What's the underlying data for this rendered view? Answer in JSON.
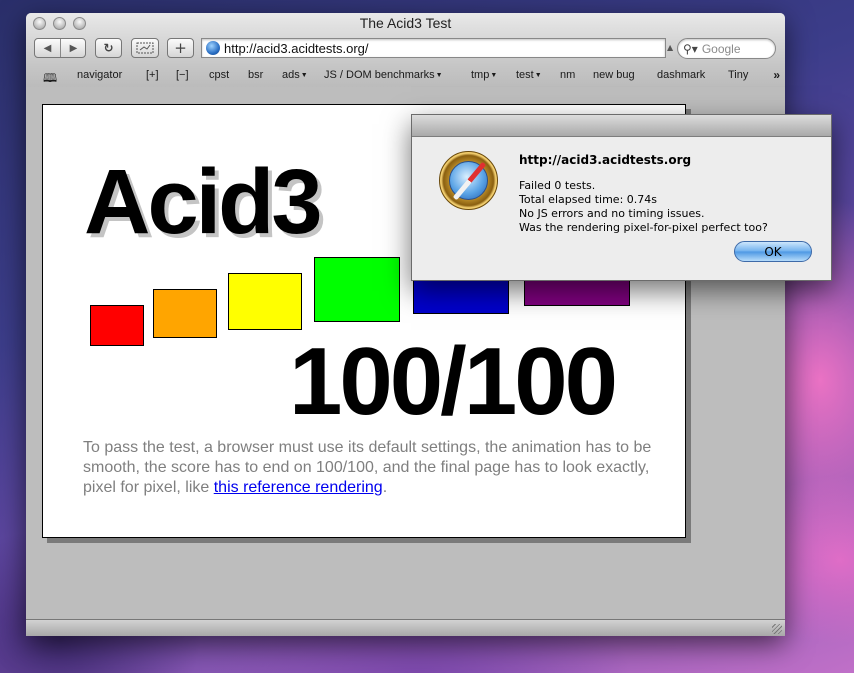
{
  "window": {
    "title": "The Acid3 Test",
    "url": "http://acid3.acidtests.org/",
    "search_placeholder": "Google"
  },
  "toolbar": {
    "back_icon": "back-arrow-icon",
    "forward_icon": "forward-arrow-icon",
    "reload_icon": "reload-icon",
    "add_bookmark_label": "+"
  },
  "bookmarks": {
    "items": [
      {
        "label": "navigator",
        "dropdown": false
      },
      {
        "label": "[+]",
        "dropdown": false
      },
      {
        "label": "[−]",
        "dropdown": false
      },
      {
        "label": "cpst",
        "dropdown": false
      },
      {
        "label": "bsr",
        "dropdown": false
      },
      {
        "label": "ads",
        "dropdown": true
      },
      {
        "label": "JS / DOM benchmarks",
        "dropdown": true
      },
      {
        "label": "tmp",
        "dropdown": true
      },
      {
        "label": "test",
        "dropdown": true
      },
      {
        "label": "nm",
        "dropdown": false
      },
      {
        "label": "new bug",
        "dropdown": false
      },
      {
        "label": "dashmark",
        "dropdown": false
      },
      {
        "label": "Tiny",
        "dropdown": false
      }
    ],
    "overflow": "»"
  },
  "page": {
    "title": "Acid3",
    "score": "100/100",
    "description": "To pass the test, a browser must use its default settings, the animation has to be smooth, the score has to end on 100/100, and the final page has to look exactly, pixel for pixel, like ",
    "link_text": "this reference rendering",
    "description_end": ".",
    "boxes": [
      {
        "color": "#ff0000"
      },
      {
        "color": "#ffa500"
      },
      {
        "color": "#ffff00"
      },
      {
        "color": "#00ff00"
      },
      {
        "color": "#0000cc"
      },
      {
        "color": "#800080"
      }
    ]
  },
  "dialog": {
    "url": "http://acid3.acidtests.org",
    "lines": [
      "Failed 0 tests.",
      "Total elapsed time: 0.74s",
      "No JS errors and no timing issues.",
      "Was the rendering pixel-for-pixel perfect too?"
    ],
    "ok_label": "OK",
    "icon": "safari-compass-icon"
  }
}
